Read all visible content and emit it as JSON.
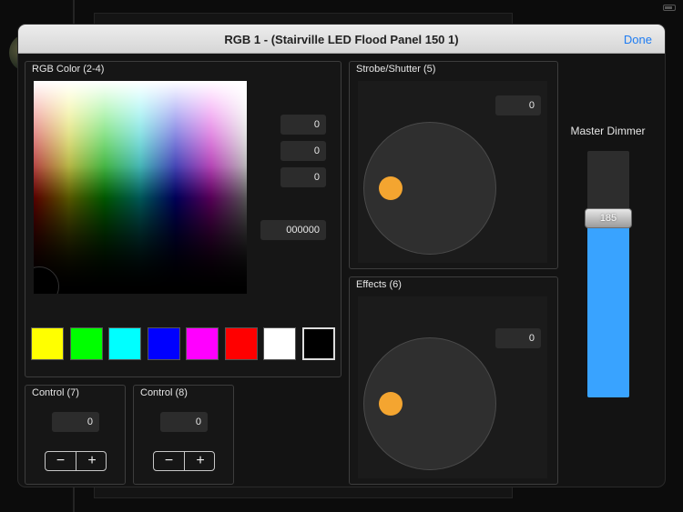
{
  "modal": {
    "title": "RGB 1 - (Stairville LED Flood Panel 150 1)",
    "done_label": "Done"
  },
  "rgb_panel": {
    "label": "RGB Color (2-4)",
    "red": "0",
    "green": "0",
    "blue": "0",
    "hex": "000000",
    "swatches": [
      {
        "name": "yellow",
        "color": "#ffff00"
      },
      {
        "name": "green",
        "color": "#00ff00"
      },
      {
        "name": "cyan",
        "color": "#00ffff"
      },
      {
        "name": "blue",
        "color": "#0000ff"
      },
      {
        "name": "magenta",
        "color": "#ff00ff"
      },
      {
        "name": "red",
        "color": "#ff0000"
      },
      {
        "name": "white",
        "color": "#ffffff"
      },
      {
        "name": "black",
        "color": "#000000"
      }
    ]
  },
  "control7": {
    "label": "Control (7)",
    "value": "0",
    "minus": "−",
    "plus": "+"
  },
  "control8": {
    "label": "Control (8)",
    "value": "0",
    "minus": "−",
    "plus": "+"
  },
  "strobe": {
    "label": "Strobe/Shutter (5)",
    "value": "0"
  },
  "effects": {
    "label": "Effects (6)",
    "value": "0"
  },
  "master": {
    "label": "Master Dimmer",
    "value": "185",
    "max": 255,
    "fill_color": "#39a3ff"
  },
  "accent_color": "#f4a530",
  "link_color": "#1e7cf2"
}
